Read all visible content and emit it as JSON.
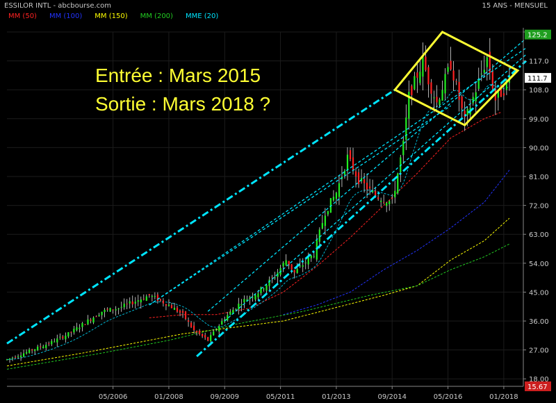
{
  "header": {
    "title": "ESSILOR INTL - abcbourse.com",
    "period": "15 ANS - MENSUEL"
  },
  "legend": [
    {
      "label": "MM (50)",
      "color": "#ff2222"
    },
    {
      "label": "MM (100)",
      "color": "#2233ff"
    },
    {
      "label": "MM (150)",
      "color": "#ffff00"
    },
    {
      "label": "MM (200)",
      "color": "#22cc22"
    },
    {
      "label": "MME (20)",
      "color": "#00e5ff"
    }
  ],
  "annotation": {
    "line1": "Entrée : Mars 2015",
    "line2": "Sortie : Mars 2018 ?"
  },
  "chart_data": {
    "type": "candlestick",
    "xlim": [
      "2003-03",
      "2018-08"
    ],
    "ylim": [
      15.67,
      126.0
    ],
    "yticks": [
      "126.0",
      "117.0",
      "108.0",
      "99.00",
      "90.00",
      "81.00",
      "72.00",
      "63.00",
      "54.00",
      "45.00",
      "36.00",
      "27.00",
      "18.00"
    ],
    "xticks": [
      "05/2006",
      "01/2008",
      "09/2009",
      "05/2011",
      "01/2013",
      "09/2014",
      "05/2016",
      "01/2018"
    ],
    "price_labels": {
      "high": "125.2",
      "last": "111.7",
      "low": "15.67"
    },
    "colors": {
      "up": "#22ee22",
      "down": "#ff2222",
      "wick": "#e0e0e0",
      "channel": "#00e5ff",
      "pattern": "#ffff33",
      "grid": "#1c1c1c",
      "axis": "#888888"
    },
    "price_anchors": [
      {
        "date": "2003-03",
        "value": 24
      },
      {
        "date": "2004-06",
        "value": 29
      },
      {
        "date": "2005-01",
        "value": 32
      },
      {
        "date": "2006-01",
        "value": 39
      },
      {
        "date": "2006-07",
        "value": 40
      },
      {
        "date": "2007-06",
        "value": 44
      },
      {
        "date": "2008-01",
        "value": 41
      },
      {
        "date": "2008-06",
        "value": 38
      },
      {
        "date": "2008-10",
        "value": 33
      },
      {
        "date": "2009-03",
        "value": 30
      },
      {
        "date": "2009-09",
        "value": 37
      },
      {
        "date": "2010-03",
        "value": 42
      },
      {
        "date": "2010-09",
        "value": 45
      },
      {
        "date": "2011-03",
        "value": 50
      },
      {
        "date": "2011-07",
        "value": 55
      },
      {
        "date": "2011-10",
        "value": 51
      },
      {
        "date": "2012-05",
        "value": 57
      },
      {
        "date": "2012-09",
        "value": 70
      },
      {
        "date": "2013-01",
        "value": 76
      },
      {
        "date": "2013-05",
        "value": 87
      },
      {
        "date": "2013-09",
        "value": 80
      },
      {
        "date": "2014-03",
        "value": 75
      },
      {
        "date": "2014-09",
        "value": 73
      },
      {
        "date": "2015-01",
        "value": 91
      },
      {
        "date": "2015-03",
        "value": 106
      },
      {
        "date": "2015-08",
        "value": 117
      },
      {
        "date": "2015-10",
        "value": 111
      },
      {
        "date": "2016-01",
        "value": 104
      },
      {
        "date": "2016-06",
        "value": 116
      },
      {
        "date": "2016-11",
        "value": 98
      },
      {
        "date": "2017-03",
        "value": 108
      },
      {
        "date": "2017-07",
        "value": 118
      },
      {
        "date": "2017-10",
        "value": 105
      },
      {
        "date": "2018-01",
        "value": 108
      },
      {
        "date": "2018-03",
        "value": 112
      }
    ],
    "moving_averages": [
      {
        "label": "MM (50)",
        "style": "dashed",
        "color": "#ff2222",
        "points": [
          {
            "date": "2007-06",
            "value": 37
          },
          {
            "date": "2008-06",
            "value": 38
          },
          {
            "date": "2009-06",
            "value": 38
          },
          {
            "date": "2010-06",
            "value": 40
          },
          {
            "date": "2011-06",
            "value": 45
          },
          {
            "date": "2012-06",
            "value": 53
          },
          {
            "date": "2013-06",
            "value": 62
          },
          {
            "date": "2014-06",
            "value": 72
          },
          {
            "date": "2015-06",
            "value": 82
          },
          {
            "date": "2016-06",
            "value": 93
          },
          {
            "date": "2017-06",
            "value": 99
          },
          {
            "date": "2017-12",
            "value": 101
          }
        ]
      },
      {
        "label": "MM (100)",
        "style": "dashed",
        "color": "#2233ff",
        "points": [
          {
            "date": "2011-06",
            "value": 38
          },
          {
            "date": "2012-06",
            "value": 41
          },
          {
            "date": "2013-06",
            "value": 45
          },
          {
            "date": "2014-06",
            "value": 52
          },
          {
            "date": "2015-06",
            "value": 58
          },
          {
            "date": "2016-06",
            "value": 65
          },
          {
            "date": "2017-06",
            "value": 73
          },
          {
            "date": "2018-03",
            "value": 83
          }
        ]
      },
      {
        "label": "MM (150)",
        "style": "dashed",
        "color": "#ffff00",
        "points": [
          {
            "date": "2003-03",
            "value": 22
          },
          {
            "date": "2005-06",
            "value": 26
          },
          {
            "date": "2008-06",
            "value": 32
          },
          {
            "date": "2011-06",
            "value": 36
          },
          {
            "date": "2014-06",
            "value": 44
          },
          {
            "date": "2015-06",
            "value": 47
          },
          {
            "date": "2016-06",
            "value": 55
          },
          {
            "date": "2017-06",
            "value": 61
          },
          {
            "date": "2018-03",
            "value": 68
          }
        ]
      },
      {
        "label": "MM (200)",
        "style": "dashed",
        "color": "#22cc22",
        "points": [
          {
            "date": "2003-03",
            "value": 21
          },
          {
            "date": "2006-01",
            "value": 26
          },
          {
            "date": "2008-01",
            "value": 30
          },
          {
            "date": "2010-01",
            "value": 35
          },
          {
            "date": "2012-01",
            "value": 39
          },
          {
            "date": "2014-01",
            "value": 44
          },
          {
            "date": "2015-06",
            "value": 47
          },
          {
            "date": "2016-06",
            "value": 52
          },
          {
            "date": "2017-06",
            "value": 56
          },
          {
            "date": "2018-03",
            "value": 60
          }
        ]
      }
    ],
    "channel_lines": [
      {
        "style": "dashdot",
        "from": {
          "date": "2003-03",
          "value": 29
        },
        "to": {
          "date": "2014-10",
          "value": 108
        }
      },
      {
        "style": "dashdot",
        "from": {
          "date": "2008-11",
          "value": 25
        },
        "to": {
          "date": "2018-09",
          "value": 117
        }
      },
      {
        "style": "dotted",
        "from": {
          "date": "2007-06",
          "value": 41
        },
        "to": {
          "date": "2018-09",
          "value": 121
        }
      },
      {
        "style": "dotted",
        "from": {
          "date": "2009-03",
          "value": 39
        },
        "to": {
          "date": "2018-09",
          "value": 124
        }
      },
      {
        "style": "dotted",
        "from": {
          "date": "2009-09",
          "value": 36
        },
        "to": {
          "date": "2018-09",
          "value": 119
        }
      },
      {
        "style": "dotted",
        "from": {
          "date": "2007-06",
          "value": 41
        },
        "to": {
          "date": "2016-06",
          "value": 103
        }
      }
    ],
    "pattern": [
      {
        "date": "2014-10",
        "value": 108
      },
      {
        "date": "2016-03",
        "value": 126
      },
      {
        "date": "2018-06",
        "value": 114
      },
      {
        "date": "2016-11",
        "value": 97
      }
    ]
  }
}
